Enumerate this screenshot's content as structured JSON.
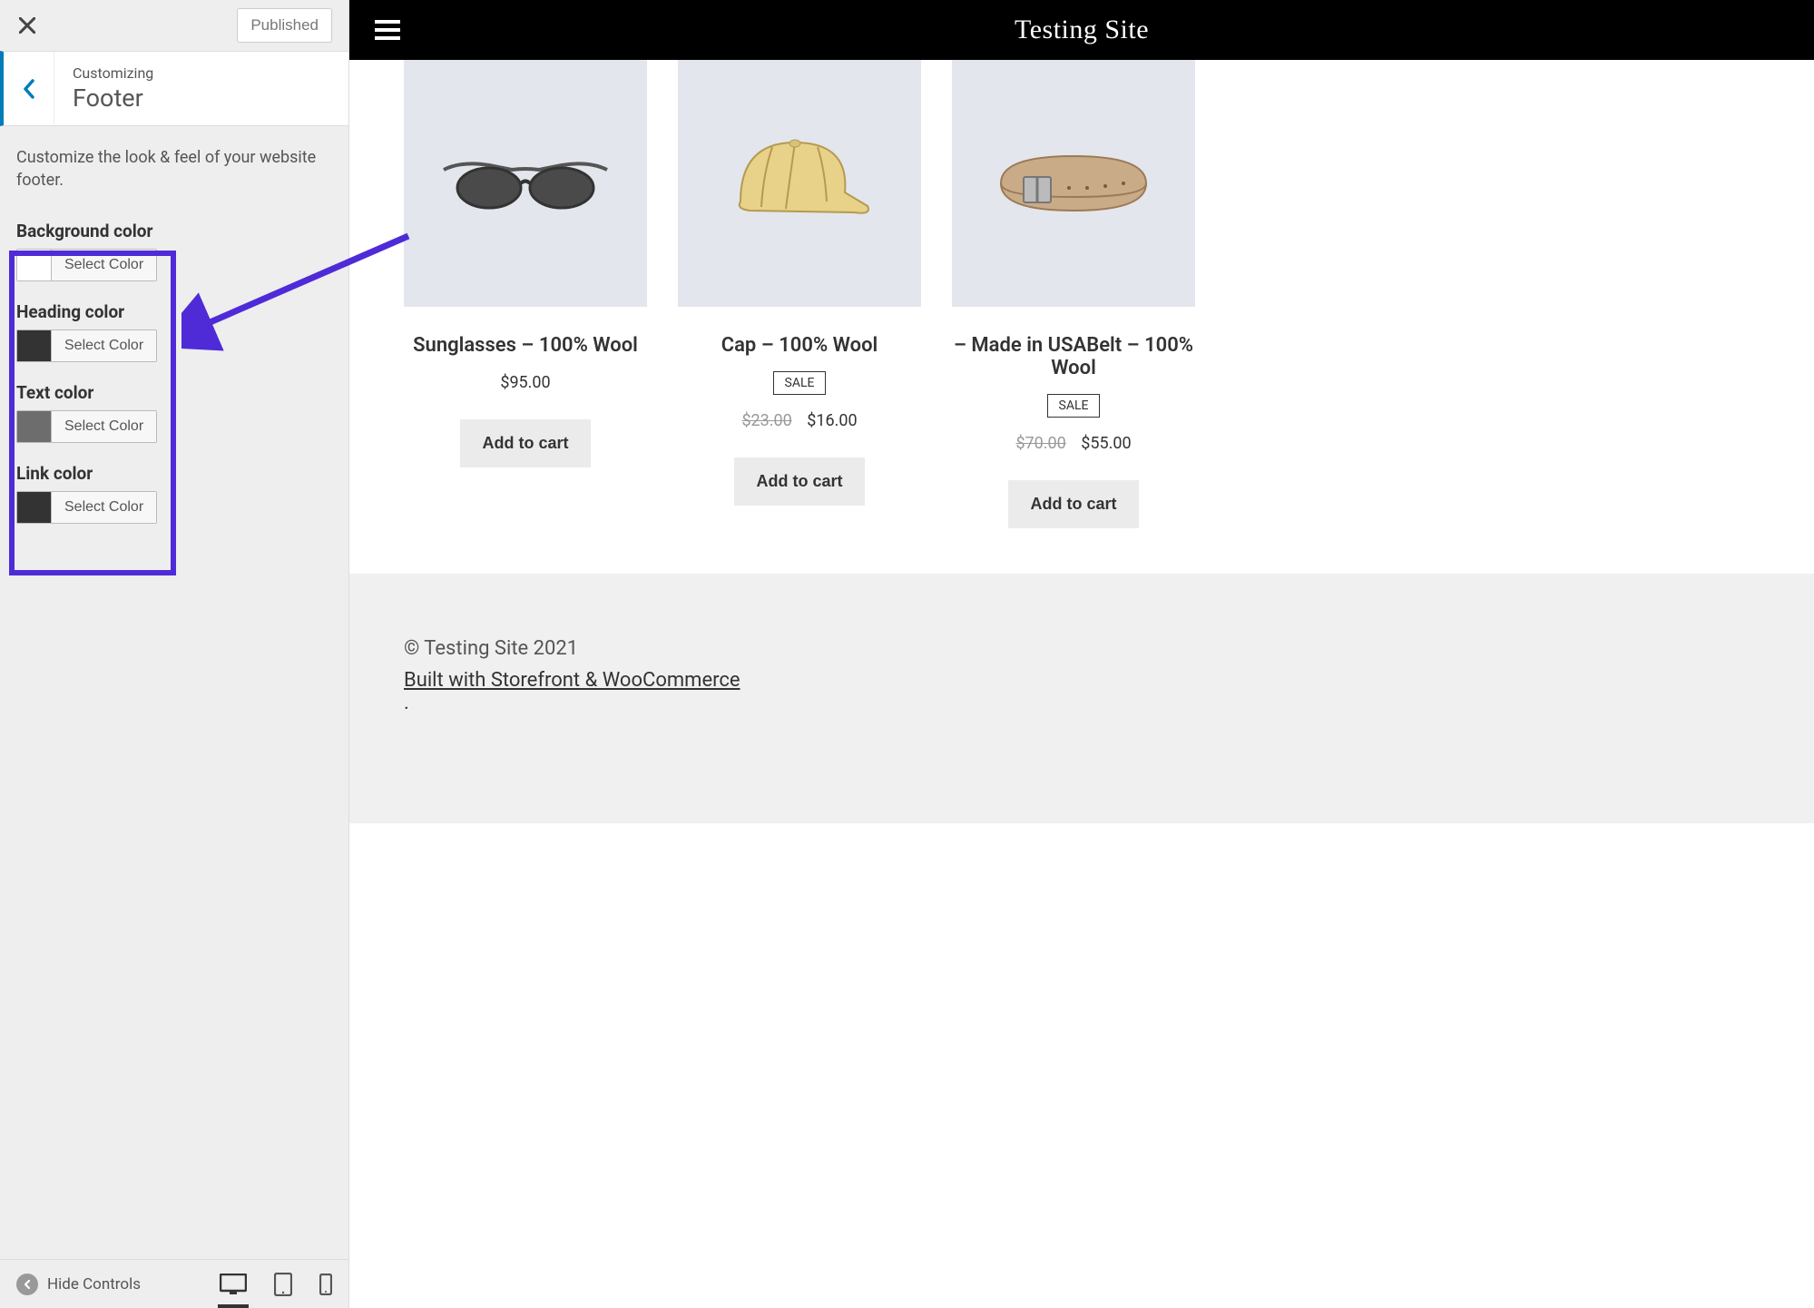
{
  "sidebar": {
    "published_label": "Published",
    "eyebrow": "Customizing",
    "title": "Footer",
    "description": "Customize the look & feel of your website footer.",
    "controls": [
      {
        "label": "Background color",
        "swatch": "#ffffff",
        "button": "Select Color"
      },
      {
        "label": "Heading color",
        "swatch": "#333333",
        "button": "Select Color"
      },
      {
        "label": "Text color",
        "swatch": "#6d6d6d",
        "button": "Select Color"
      },
      {
        "label": "Link color",
        "swatch": "#333333",
        "button": "Select Color"
      }
    ],
    "hide_controls_label": "Hide Controls"
  },
  "preview": {
    "site_title": "Testing Site",
    "products": [
      {
        "title": "Sunglasses – 100% Wool",
        "sale": false,
        "old_price": "",
        "price": "$95.00",
        "atc": "Add to cart"
      },
      {
        "title": "Cap – 100% Wool",
        "sale": true,
        "old_price": "$23.00",
        "price": "$16.00",
        "atc": "Add to cart"
      },
      {
        "title": "– Made in USABelt – 100% Wool",
        "sale": true,
        "old_price": "$70.00",
        "price": "$55.00",
        "atc": "Add to cart"
      }
    ],
    "sale_badge": "SALE",
    "footer_copyright": "© Testing Site 2021",
    "footer_built": "Built with Storefront & WooCommerce",
    "footer_built_suffix": "."
  }
}
